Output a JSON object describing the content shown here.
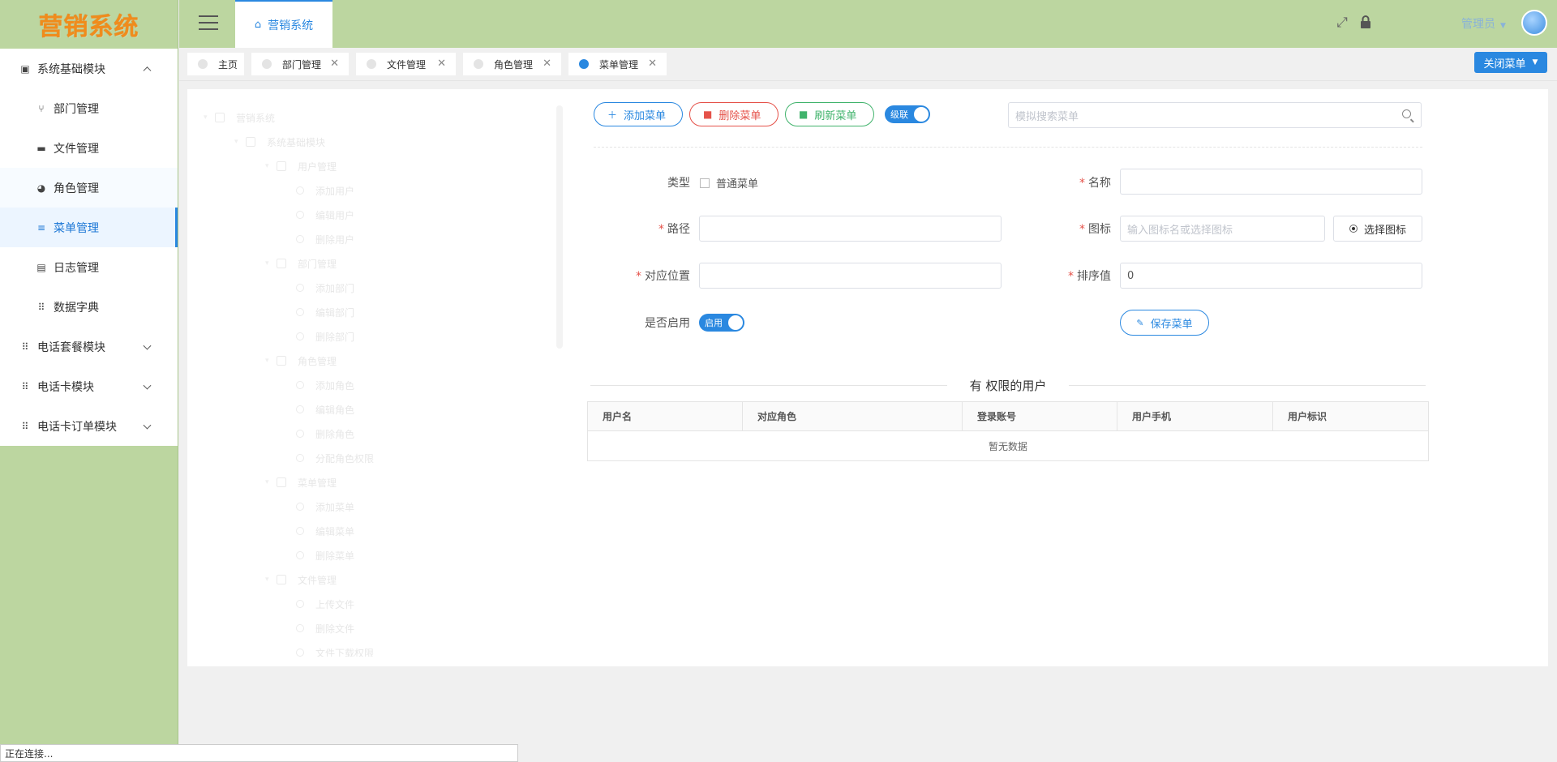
{
  "logo": "营销系统",
  "sidebar": {
    "items": [
      {
        "label": "系统基础模块",
        "icon": "chart-icon",
        "level": 0,
        "expanded": true
      },
      {
        "label": "部门管理",
        "icon": "branch-icon",
        "level": 1
      },
      {
        "label": "文件管理",
        "icon": "folder-icon",
        "level": 1
      },
      {
        "label": "角色管理",
        "icon": "users-icon",
        "level": 1
      },
      {
        "label": "菜单管理",
        "icon": "list-icon",
        "level": 1,
        "active": true
      },
      {
        "label": "日志管理",
        "icon": "log-icon",
        "level": 1
      },
      {
        "label": "数据字典",
        "icon": "grid-icon",
        "level": 1
      },
      {
        "label": "电话套餐模块",
        "icon": "grid-icon",
        "level": 0,
        "expanded": false
      },
      {
        "label": "电话卡模块",
        "icon": "grid-icon",
        "level": 0,
        "expanded": false
      },
      {
        "label": "电话卡订单模块",
        "icon": "grid-icon",
        "level": 0,
        "expanded": false
      }
    ]
  },
  "header": {
    "tab_label": "营销系统",
    "admin_label": "管理员"
  },
  "tabs": [
    {
      "label": "主页",
      "closable": false
    },
    {
      "label": "部门管理",
      "closable": true
    },
    {
      "label": "文件管理",
      "closable": true
    },
    {
      "label": "角色管理",
      "closable": true
    },
    {
      "label": "菜单管理",
      "closable": true,
      "active": true
    }
  ],
  "close_menu_label": "关闭菜单",
  "toolbar": {
    "add_label": "添加菜单",
    "delete_label": "删除菜单",
    "refresh_label": "刷新菜单",
    "cascade_label": "级联",
    "search_placeholder": "模拟搜索菜单"
  },
  "tree": {
    "rows": [
      {
        "label": "营销系统",
        "depth": 0,
        "kind": "root"
      },
      {
        "label": "系统基础模块",
        "depth": 1,
        "kind": "folder"
      },
      {
        "label": "用户管理",
        "depth": 2,
        "kind": "folder"
      },
      {
        "label": "添加用户",
        "depth": 3,
        "kind": "leaf"
      },
      {
        "label": "编辑用户",
        "depth": 3,
        "kind": "leaf"
      },
      {
        "label": "删除用户",
        "depth": 3,
        "kind": "leaf"
      },
      {
        "label": "部门管理",
        "depth": 2,
        "kind": "folder"
      },
      {
        "label": "添加部门",
        "depth": 3,
        "kind": "leaf"
      },
      {
        "label": "编辑部门",
        "depth": 3,
        "kind": "leaf"
      },
      {
        "label": "删除部门",
        "depth": 3,
        "kind": "leaf"
      },
      {
        "label": "角色管理",
        "depth": 2,
        "kind": "folder"
      },
      {
        "label": "添加角色",
        "depth": 3,
        "kind": "leaf"
      },
      {
        "label": "编辑角色",
        "depth": 3,
        "kind": "leaf"
      },
      {
        "label": "删除角色",
        "depth": 3,
        "kind": "leaf"
      },
      {
        "label": "分配角色权限",
        "depth": 3,
        "kind": "leaf"
      },
      {
        "label": "菜单管理",
        "depth": 2,
        "kind": "folder"
      },
      {
        "label": "添加菜单",
        "depth": 3,
        "kind": "leaf"
      },
      {
        "label": "编辑菜单",
        "depth": 3,
        "kind": "leaf"
      },
      {
        "label": "删除菜单",
        "depth": 3,
        "kind": "leaf"
      },
      {
        "label": "文件管理",
        "depth": 2,
        "kind": "folder"
      },
      {
        "label": "上传文件",
        "depth": 3,
        "kind": "leaf"
      },
      {
        "label": "删除文件",
        "depth": 3,
        "kind": "leaf"
      },
      {
        "label": "文件下载权限",
        "depth": 3,
        "kind": "leaf"
      }
    ]
  },
  "form": {
    "type_label": "类型",
    "type_option": "普通菜单",
    "name_label": "名称",
    "name_value": "",
    "path_label": "路径",
    "path_value": "",
    "icon_label": "图标",
    "icon_placeholder": "输入图标名或选择图标",
    "pick_icon_label": "选择图标",
    "position_label": "对应位置",
    "position_value": "",
    "sort_label": "排序值",
    "sort_value": "0",
    "enabled_label": "是否启用",
    "enabled_switch": "启用",
    "save_label": "保存菜单"
  },
  "users_section": {
    "title": "有 权限的用户",
    "columns": [
      "用户名",
      "对应角色",
      "登录账号",
      "用户手机",
      "用户标识"
    ],
    "empty_text": "暂无数据"
  },
  "status_text": "正在连接..."
}
